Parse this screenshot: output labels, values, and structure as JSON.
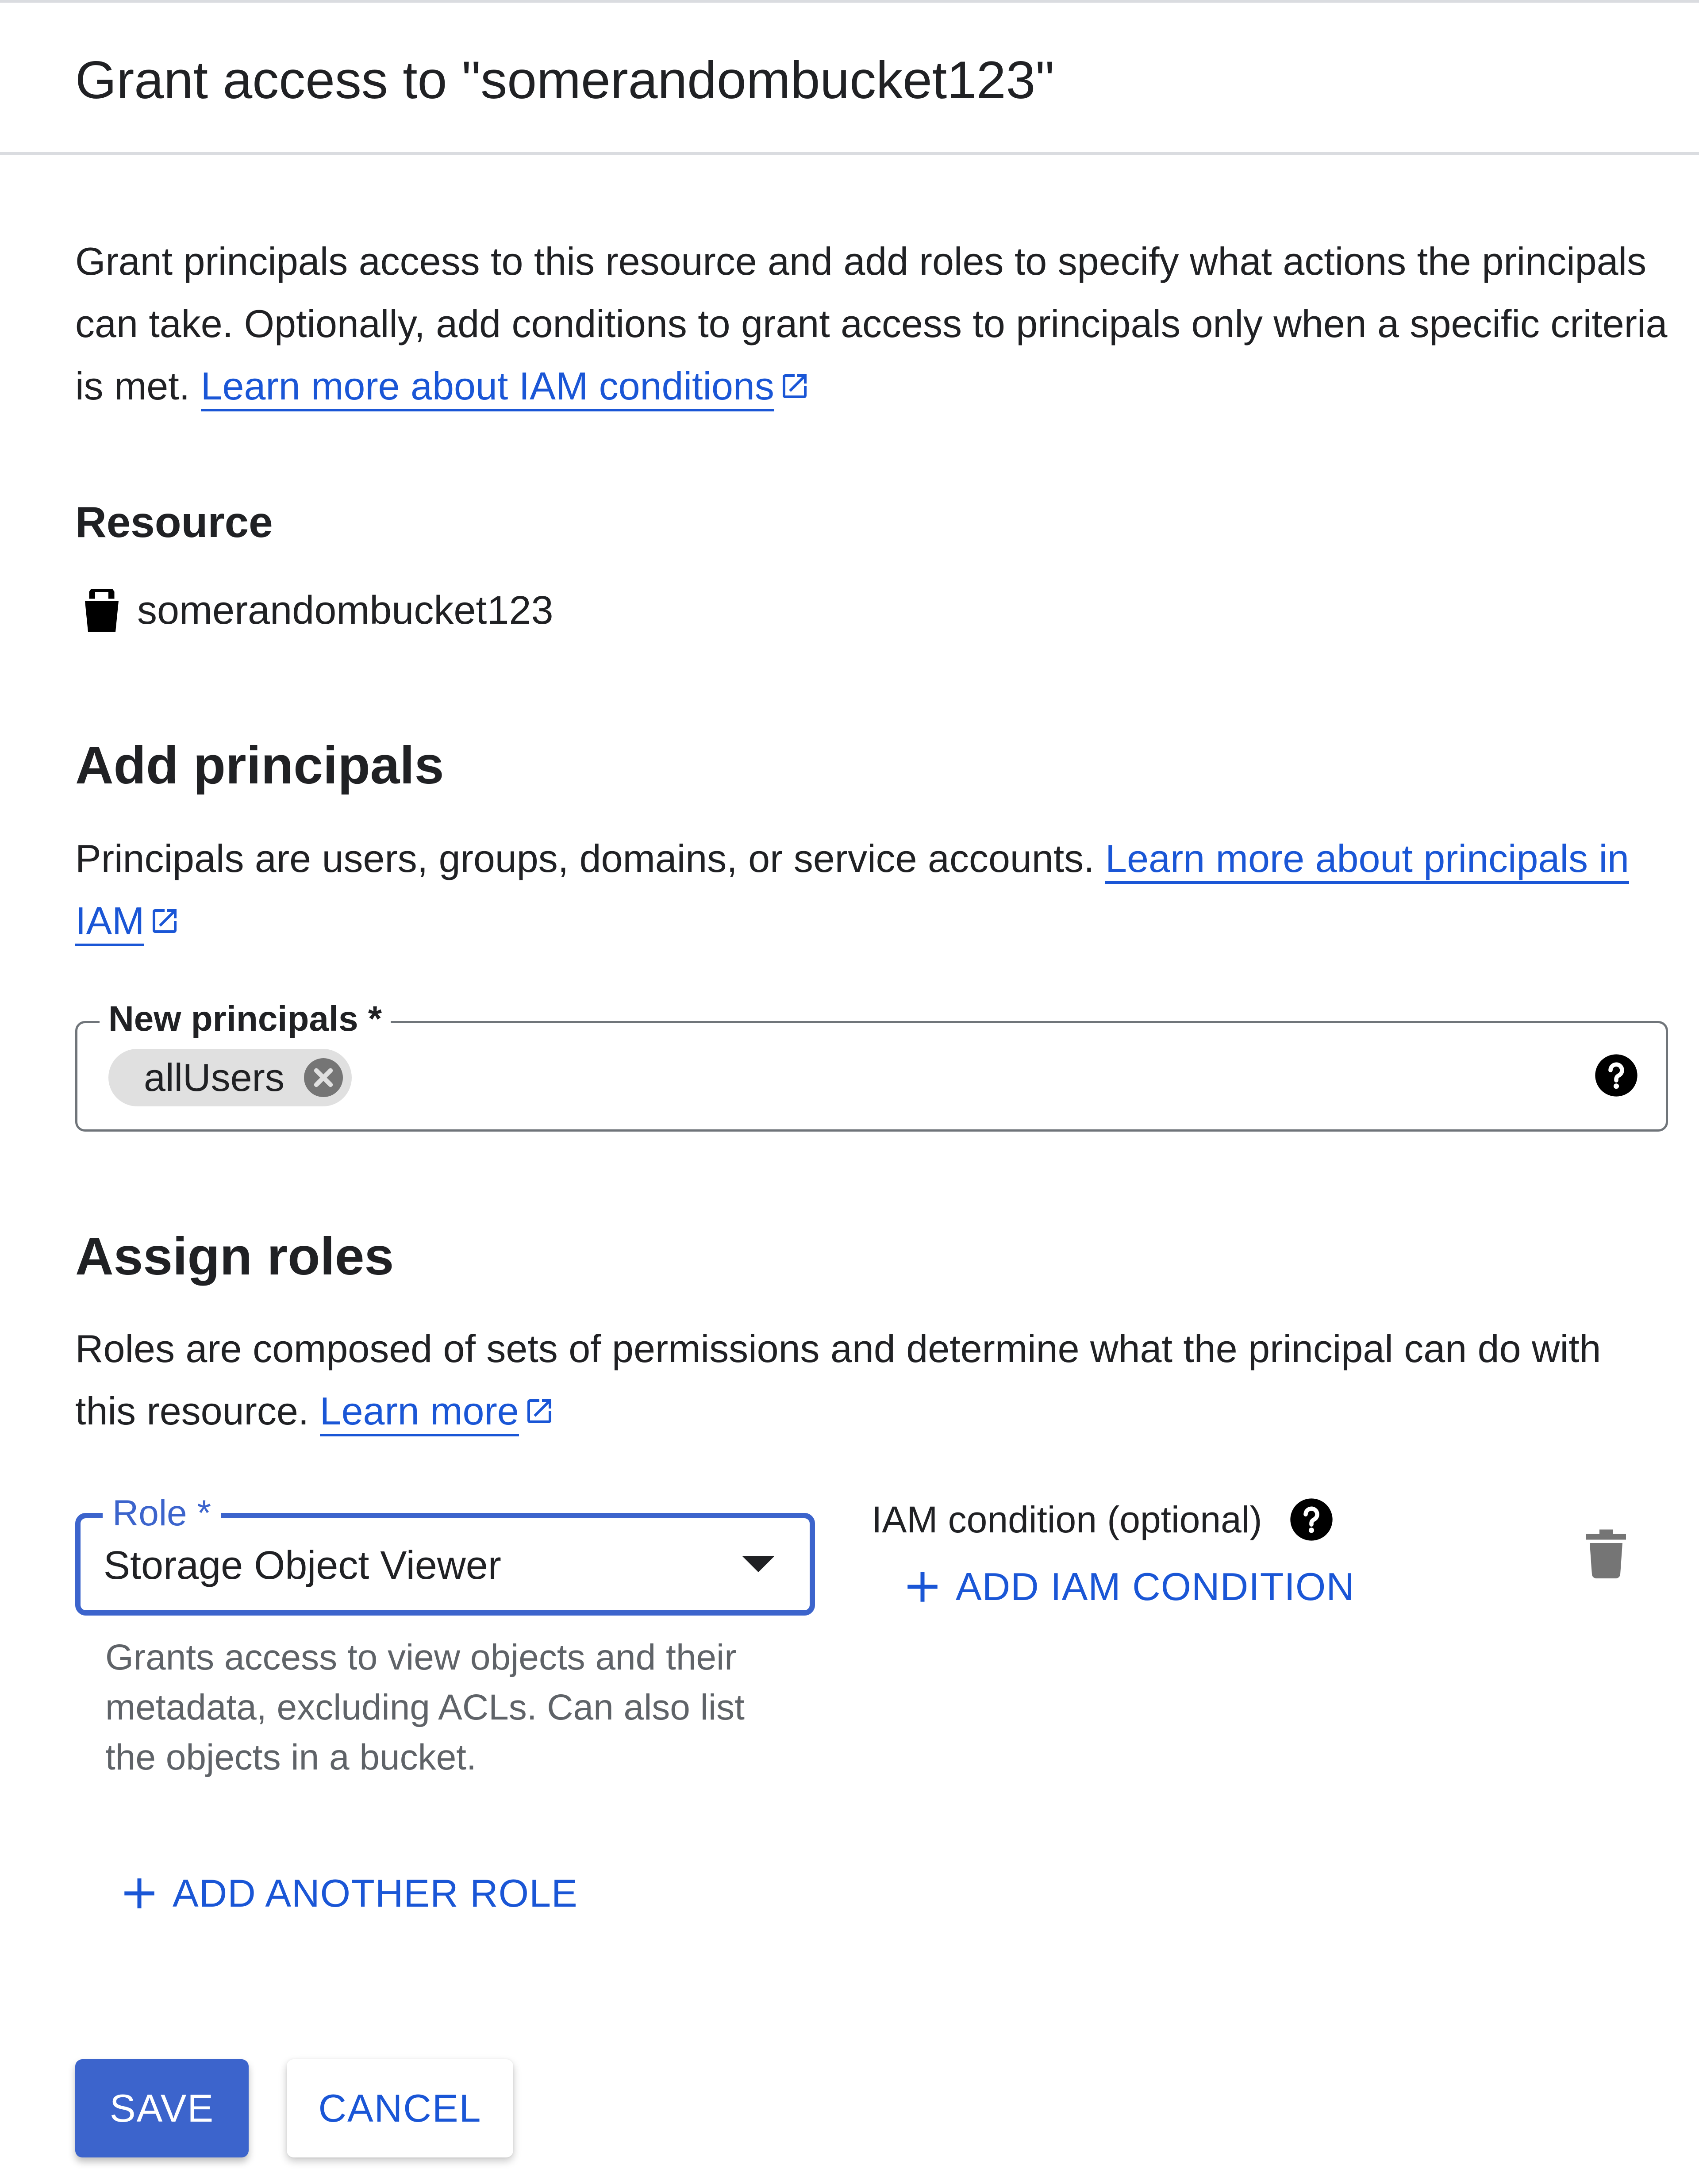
{
  "dialog": {
    "title": "Grant access to \"somerandombucket123\"",
    "intro": {
      "text": "Grant principals access to this resource and add roles to specify what actions the principals can take. Optionally, add conditions to grant access to principals only when a specific criteria is met. ",
      "link_label": "Learn more about IAM conditions",
      "link_icon": "external-link-icon"
    }
  },
  "resource": {
    "heading": "Resource",
    "icon": "bucket-icon",
    "name": "somerandombucket123"
  },
  "principals": {
    "heading": "Add principals",
    "description": "Principals are users, groups, domains, or service accounts. ",
    "link_label": "Learn more about principals in IAM",
    "field_label": "New principals *",
    "chips": [
      {
        "label": "allUsers",
        "remove_icon": "cancel-circle-icon"
      }
    ],
    "help_icon": "help-circle-icon"
  },
  "roles": {
    "heading": "Assign roles",
    "description": "Roles are composed of sets of permissions and determine what the principal can do with this resource. ",
    "link_label": "Learn more",
    "role_field_label": "Role *",
    "role_value": "Storage Object Viewer",
    "role_help": "Grants access to view objects and their metadata, excluding ACLs. Can also list the objects in a bucket.",
    "condition_label": "IAM condition (optional)",
    "add_condition_label": "ADD IAM CONDITION",
    "add_role_label": "ADD ANOTHER ROLE",
    "delete_icon": "trash-icon"
  },
  "actions": {
    "save_label": "SAVE",
    "cancel_label": "CANCEL"
  },
  "colors": {
    "accent": "#3c64cc",
    "link": "#1a56d6",
    "text": "#202124",
    "secondary_text": "#5f6368",
    "chip_bg": "#e0e0e0",
    "divider": "#dadce0"
  }
}
